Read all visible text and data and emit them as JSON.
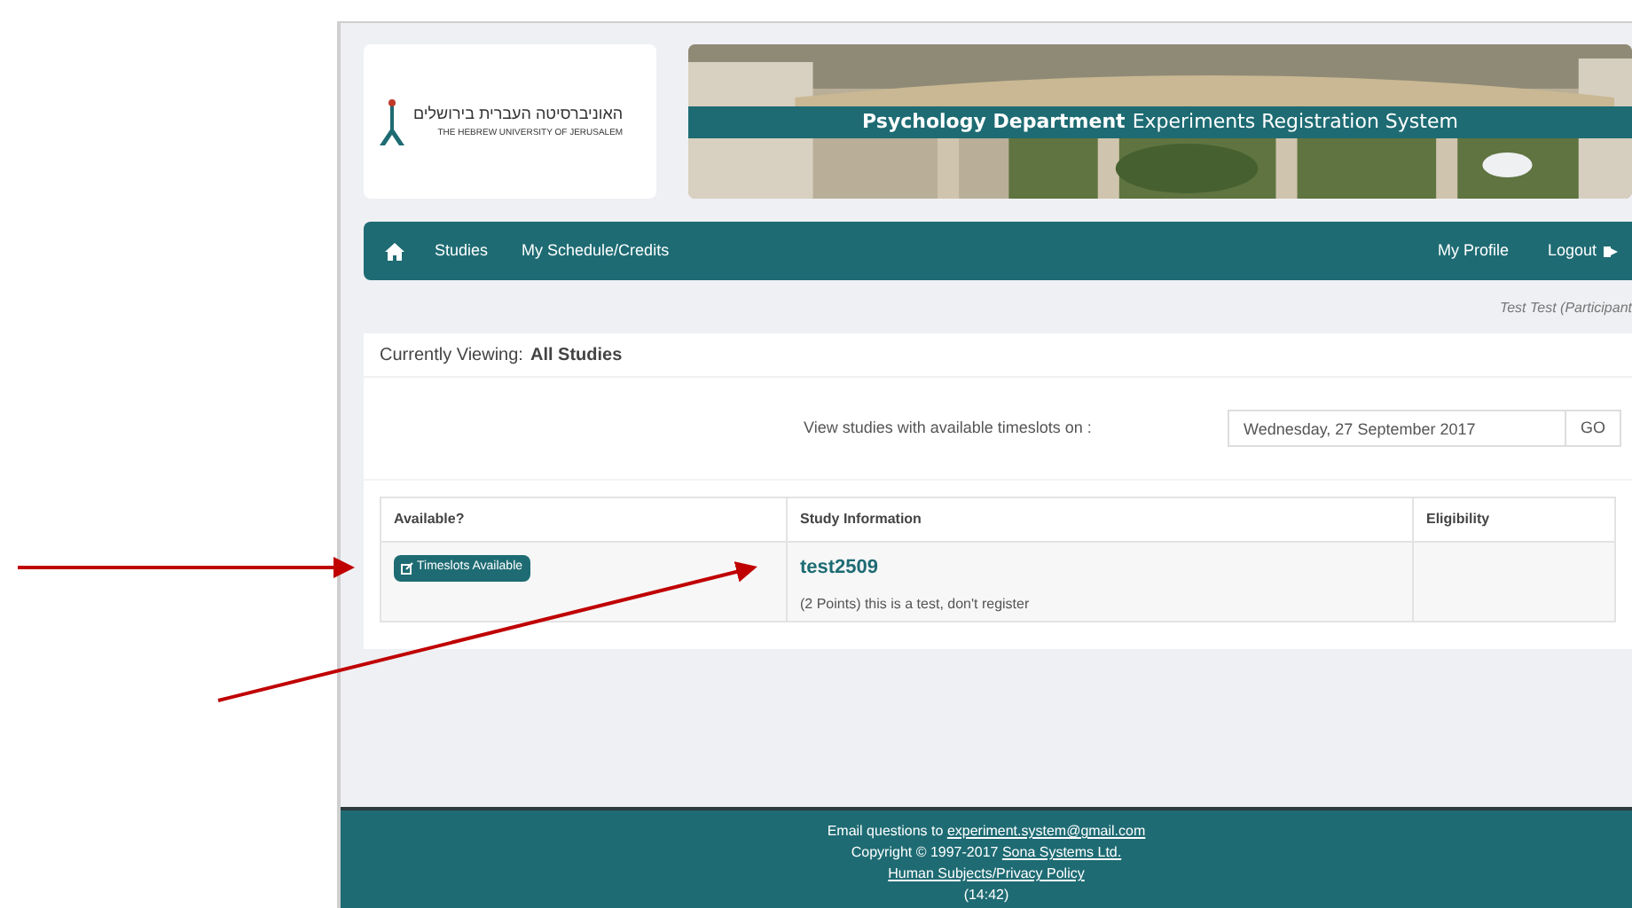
{
  "logo": {
    "hebrew": "האוניברסיטה העברית בירושלים",
    "english": "THE HEBREW UNIVERSITY OF JERUSALEM"
  },
  "banner": {
    "title_bold": "Psychology Department",
    "title_rest": "Experiments Registration System"
  },
  "nav": {
    "left": [
      "Studies",
      "My Schedule/Credits"
    ],
    "right": [
      "My Profile",
      "Logout"
    ]
  },
  "user": "Test Test (Participant",
  "viewing": {
    "label": "Currently Viewing:",
    "value": "All Studies"
  },
  "filter": {
    "label": "View studies with available timeslots on :",
    "date": "Wednesday, 27 September 2017",
    "button": "GO"
  },
  "table": {
    "columns": [
      "Available?",
      "Study Information",
      "Eligibility"
    ],
    "rows": [
      {
        "available": "Timeslots Available",
        "title": "test2509",
        "description": "(2 Points) this is a test, don't register"
      }
    ]
  },
  "footer": {
    "email_prefix": "Email questions to",
    "email": "experiment.system@gmail.com",
    "copyright": "Copyright © 1997-2017",
    "company": "Sona Systems Ltd.",
    "policy": "Human Subjects/Privacy Policy",
    "time": "(14:42)"
  }
}
